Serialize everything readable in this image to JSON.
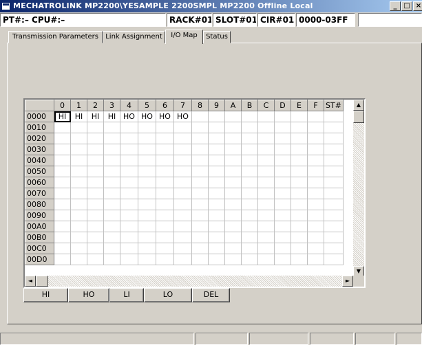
{
  "window": {
    "title": "MECHATROLINK  MP2200\\YESAMPLE  2200SMPL  MP2200   Offline  Local",
    "minimize": "_",
    "maximize": "□",
    "close": "×"
  },
  "info": {
    "pt_cpu": "PT#:– CPU#:–",
    "rack": "RACK#01",
    "slot": "SLOT#01",
    "cir": "CIR#01",
    "range": "0000-03FF",
    "extra": ""
  },
  "tabs": [
    {
      "label": "Transmission Parameters"
    },
    {
      "label": "Link Assignment"
    },
    {
      "label": "I/O Map"
    },
    {
      "label": "Status"
    }
  ],
  "active_tab": "I/O Map",
  "grid": {
    "columns": [
      "0",
      "1",
      "2",
      "3",
      "4",
      "5",
      "6",
      "7",
      "8",
      "9",
      "A",
      "B",
      "C",
      "D",
      "E",
      "F",
      "ST#"
    ],
    "rows": [
      {
        "addr": "0000",
        "cells": [
          "HI",
          "HI",
          "HI",
          "HI",
          "HO",
          "HO",
          "HO",
          "HO",
          "",
          "",
          "",
          "",
          "",
          "",
          "",
          "",
          ""
        ]
      },
      {
        "addr": "0010",
        "cells": [
          "",
          "",
          "",
          "",
          "",
          "",
          "",
          "",
          "",
          "",
          "",
          "",
          "",
          "",
          "",
          "",
          ""
        ]
      },
      {
        "addr": "0020",
        "cells": [
          "",
          "",
          "",
          "",
          "",
          "",
          "",
          "",
          "",
          "",
          "",
          "",
          "",
          "",
          "",
          "",
          ""
        ]
      },
      {
        "addr": "0030",
        "cells": [
          "",
          "",
          "",
          "",
          "",
          "",
          "",
          "",
          "",
          "",
          "",
          "",
          "",
          "",
          "",
          "",
          ""
        ]
      },
      {
        "addr": "0040",
        "cells": [
          "",
          "",
          "",
          "",
          "",
          "",
          "",
          "",
          "",
          "",
          "",
          "",
          "",
          "",
          "",
          "",
          ""
        ]
      },
      {
        "addr": "0050",
        "cells": [
          "",
          "",
          "",
          "",
          "",
          "",
          "",
          "",
          "",
          "",
          "",
          "",
          "",
          "",
          "",
          "",
          ""
        ]
      },
      {
        "addr": "0060",
        "cells": [
          "",
          "",
          "",
          "",
          "",
          "",
          "",
          "",
          "",
          "",
          "",
          "",
          "",
          "",
          "",
          "",
          ""
        ]
      },
      {
        "addr": "0070",
        "cells": [
          "",
          "",
          "",
          "",
          "",
          "",
          "",
          "",
          "",
          "",
          "",
          "",
          "",
          "",
          "",
          "",
          ""
        ]
      },
      {
        "addr": "0080",
        "cells": [
          "",
          "",
          "",
          "",
          "",
          "",
          "",
          "",
          "",
          "",
          "",
          "",
          "",
          "",
          "",
          "",
          ""
        ]
      },
      {
        "addr": "0090",
        "cells": [
          "",
          "",
          "",
          "",
          "",
          "",
          "",
          "",
          "",
          "",
          "",
          "",
          "",
          "",
          "",
          "",
          ""
        ]
      },
      {
        "addr": "00A0",
        "cells": [
          "",
          "",
          "",
          "",
          "",
          "",
          "",
          "",
          "",
          "",
          "",
          "",
          "",
          "",
          "",
          "",
          ""
        ]
      },
      {
        "addr": "00B0",
        "cells": [
          "",
          "",
          "",
          "",
          "",
          "",
          "",
          "",
          "",
          "",
          "",
          "",
          "",
          "",
          "",
          "",
          ""
        ]
      },
      {
        "addr": "00C0",
        "cells": [
          "",
          "",
          "",
          "",
          "",
          "",
          "",
          "",
          "",
          "",
          "",
          "",
          "",
          "",
          "",
          "",
          ""
        ]
      },
      {
        "addr": "00D0",
        "cells": [
          "",
          "",
          "",
          "",
          "",
          "",
          "",
          "",
          "",
          "",
          "",
          "",
          "",
          "",
          "",
          "",
          ""
        ]
      }
    ]
  },
  "scroll": {
    "up": "▲",
    "down": "▼",
    "left": "◄",
    "right": "►"
  },
  "buttons": {
    "hi": "HI",
    "ho": "HO",
    "li": "LI",
    "lo": "LO",
    "del": "DEL"
  }
}
